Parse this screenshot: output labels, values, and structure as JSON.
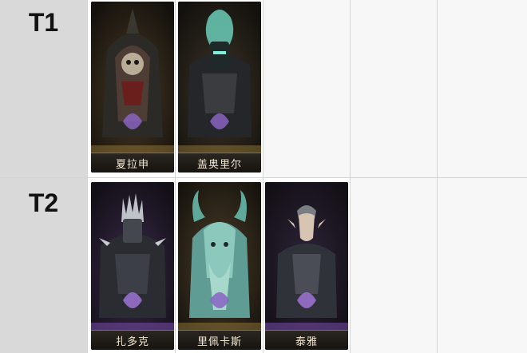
{
  "tiers": [
    {
      "label": "T1",
      "cards": [
        {
          "name": "夏拉申",
          "icon": "skeleton-lich-portrait",
          "theme": "gold"
        },
        {
          "name": "盖奥里尔",
          "icon": "spectral-flame-knight-portrait",
          "theme": "gold"
        }
      ]
    },
    {
      "label": "T2",
      "cards": [
        {
          "name": "扎多克",
          "icon": "spiked-armor-knight-portrait",
          "theme": "purple"
        },
        {
          "name": "里佩卡斯",
          "icon": "horned-forest-spirit-portrait",
          "theme": "gold"
        },
        {
          "name": "泰雅",
          "icon": "elf-warrior-portrait",
          "theme": "purple"
        }
      ]
    }
  ],
  "colors": {
    "tier_bg": "#d9d9d9",
    "card_bg": "#1a1714",
    "name_text": "#f1e6cf",
    "gold_glow": "#c8a24a",
    "purple_glow": "#7a4fb0"
  }
}
